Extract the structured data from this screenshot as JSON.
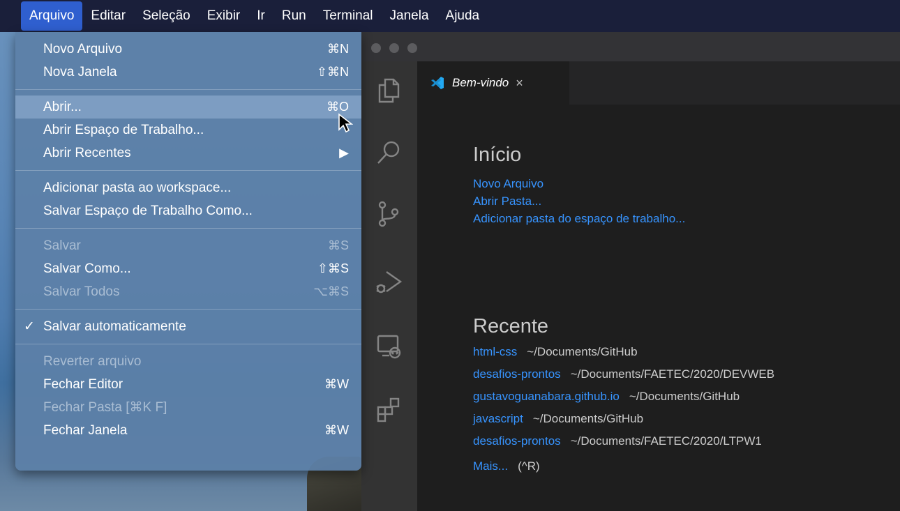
{
  "menubar": {
    "items": [
      "Arquivo",
      "Editar",
      "Seleção",
      "Exibir",
      "Ir",
      "Run",
      "Terminal",
      "Janela",
      "Ajuda"
    ],
    "active": "Arquivo"
  },
  "file_menu": {
    "items": [
      {
        "label": "Novo Arquivo",
        "shortcut": "⌘N",
        "enabled": true
      },
      {
        "label": "Nova Janela",
        "shortcut": "⇧⌘N",
        "enabled": true
      },
      {
        "label": "Abrir...",
        "shortcut": "⌘O",
        "enabled": true,
        "highlighted": true
      },
      {
        "label": "Abrir Espaço de Trabalho...",
        "shortcut": "",
        "enabled": true
      },
      {
        "label": "Abrir Recentes",
        "shortcut": "▶",
        "enabled": true
      },
      {
        "label": "Adicionar pasta ao workspace...",
        "shortcut": "",
        "enabled": true
      },
      {
        "label": "Salvar Espaço de Trabalho Como...",
        "shortcut": "",
        "enabled": true
      },
      {
        "label": "Salvar",
        "shortcut": "⌘S",
        "enabled": false
      },
      {
        "label": "Salvar Como...",
        "shortcut": "⇧⌘S",
        "enabled": true
      },
      {
        "label": "Salvar Todos",
        "shortcut": "⌥⌘S",
        "enabled": false
      },
      {
        "label": "Salvar automaticamente",
        "shortcut": "",
        "enabled": true,
        "checked": true,
        "check_mark": "✓"
      },
      {
        "label": "Reverter arquivo",
        "shortcut": "",
        "enabled": false
      },
      {
        "label": "Fechar Editor",
        "shortcut": "⌘W",
        "enabled": true
      },
      {
        "label": "Fechar Pasta [⌘K F]",
        "shortcut": "",
        "enabled": false
      },
      {
        "label": "Fechar Janela",
        "shortcut": "⌘W",
        "enabled": true
      }
    ]
  },
  "editor": {
    "tab": {
      "label": "Bem-vindo",
      "close": "×"
    },
    "activity_icons": [
      "files-icon",
      "search-icon",
      "source-control-icon",
      "run-debug-icon",
      "remote-explorer-icon",
      "extensions-icon"
    ],
    "start": {
      "heading": "Início",
      "links": [
        "Novo Arquivo",
        "Abrir Pasta...",
        "Adicionar pasta do espaço de trabalho..."
      ]
    },
    "recent": {
      "heading": "Recente",
      "items": [
        {
          "name": "html-css",
          "path": "~/Documents/GitHub"
        },
        {
          "name": "desafios-prontos",
          "path": "~/Documents/FAETEC/2020/DEVWEB"
        },
        {
          "name": "gustavoguanabara.github.io",
          "path": "~/Documents/GitHub"
        },
        {
          "name": "javascript",
          "path": "~/Documents/GitHub"
        },
        {
          "name": "desafios-prontos",
          "path": "~/Documents/FAETEC/2020/LTPW1"
        }
      ],
      "more_label": "Mais...",
      "more_shortcut": "(^R)"
    }
  },
  "colors": {
    "menubar": "#1a1f3a",
    "menu_active": "#2f5fcf",
    "link": "#3794ff",
    "vscode_blue": "#23a9f2"
  }
}
